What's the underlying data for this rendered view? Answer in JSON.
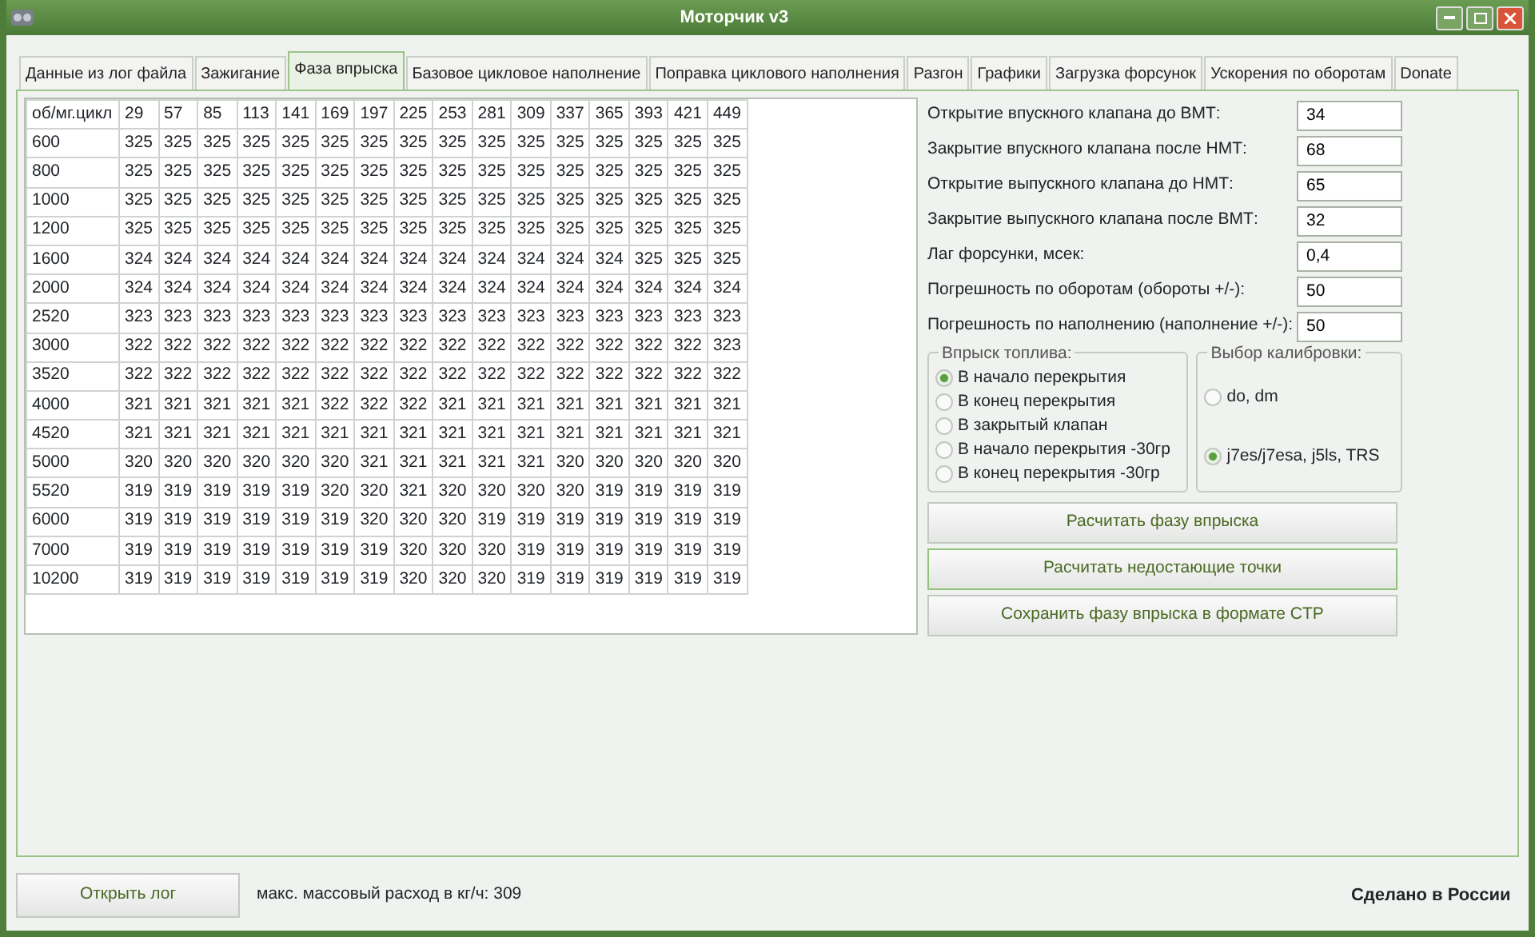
{
  "window": {
    "title": "Моторчик v3"
  },
  "tabs": [
    {
      "label": "Данные из лог файла",
      "selected": false
    },
    {
      "label": "Зажигание",
      "selected": false
    },
    {
      "label": "Фаза впрыска",
      "selected": true
    },
    {
      "label": "Базовое цикловое наполнение",
      "selected": false
    },
    {
      "label": "Поправка циклового наполнения",
      "selected": false
    },
    {
      "label": "Разгон",
      "selected": false
    },
    {
      "label": "Графики",
      "selected": false
    },
    {
      "label": "Загрузка форсунок",
      "selected": false
    },
    {
      "label": "Ускорения по оборотам",
      "selected": false
    },
    {
      "label": "Donate",
      "selected": false
    }
  ],
  "table": {
    "columns": [
      "об/мг.цикл",
      "29",
      "57",
      "85",
      "113",
      "141",
      "169",
      "197",
      "225",
      "253",
      "281",
      "309",
      "337",
      "365",
      "393",
      "421",
      "449"
    ],
    "rows": [
      [
        "600",
        "325",
        "325",
        "325",
        "325",
        "325",
        "325",
        "325",
        "325",
        "325",
        "325",
        "325",
        "325",
        "325",
        "325",
        "325",
        "325"
      ],
      [
        "800",
        "325",
        "325",
        "325",
        "325",
        "325",
        "325",
        "325",
        "325",
        "325",
        "325",
        "325",
        "325",
        "325",
        "325",
        "325",
        "325"
      ],
      [
        "1000",
        "325",
        "325",
        "325",
        "325",
        "325",
        "325",
        "325",
        "325",
        "325",
        "325",
        "325",
        "325",
        "325",
        "325",
        "325",
        "325"
      ],
      [
        "1200",
        "325",
        "325",
        "325",
        "325",
        "325",
        "325",
        "325",
        "325",
        "325",
        "325",
        "325",
        "325",
        "325",
        "325",
        "325",
        "325"
      ],
      [
        "1600",
        "324",
        "324",
        "324",
        "324",
        "324",
        "324",
        "324",
        "324",
        "324",
        "324",
        "324",
        "324",
        "324",
        "325",
        "325",
        "325"
      ],
      [
        "2000",
        "324",
        "324",
        "324",
        "324",
        "324",
        "324",
        "324",
        "324",
        "324",
        "324",
        "324",
        "324",
        "324",
        "324",
        "324",
        "324"
      ],
      [
        "2520",
        "323",
        "323",
        "323",
        "323",
        "323",
        "323",
        "323",
        "323",
        "323",
        "323",
        "323",
        "323",
        "323",
        "323",
        "323",
        "323"
      ],
      [
        "3000",
        "322",
        "322",
        "322",
        "322",
        "322",
        "322",
        "322",
        "322",
        "322",
        "322",
        "322",
        "322",
        "322",
        "322",
        "322",
        "323"
      ],
      [
        "3520",
        "322",
        "322",
        "322",
        "322",
        "322",
        "322",
        "322",
        "322",
        "322",
        "322",
        "322",
        "322",
        "322",
        "322",
        "322",
        "322"
      ],
      [
        "4000",
        "321",
        "321",
        "321",
        "321",
        "321",
        "322",
        "322",
        "322",
        "321",
        "321",
        "321",
        "321",
        "321",
        "321",
        "321",
        "321"
      ],
      [
        "4520",
        "321",
        "321",
        "321",
        "321",
        "321",
        "321",
        "321",
        "321",
        "321",
        "321",
        "321",
        "321",
        "321",
        "321",
        "321",
        "321"
      ],
      [
        "5000",
        "320",
        "320",
        "320",
        "320",
        "320",
        "320",
        "321",
        "321",
        "321",
        "321",
        "321",
        "320",
        "320",
        "320",
        "320",
        "320"
      ],
      [
        "5520",
        "319",
        "319",
        "319",
        "319",
        "319",
        "320",
        "320",
        "321",
        "320",
        "320",
        "320",
        "320",
        "319",
        "319",
        "319",
        "319"
      ],
      [
        "6000",
        "319",
        "319",
        "319",
        "319",
        "319",
        "319",
        "320",
        "320",
        "320",
        "319",
        "319",
        "319",
        "319",
        "319",
        "319",
        "319"
      ],
      [
        "7000",
        "319",
        "319",
        "319",
        "319",
        "319",
        "319",
        "319",
        "320",
        "320",
        "320",
        "319",
        "319",
        "319",
        "319",
        "319",
        "319"
      ],
      [
        "10200",
        "319",
        "319",
        "319",
        "319",
        "319",
        "319",
        "319",
        "320",
        "320",
        "320",
        "319",
        "319",
        "319",
        "319",
        "319",
        "319"
      ]
    ]
  },
  "fields": [
    {
      "label": "Открытие впускного клапана до ВМТ:",
      "value": "34"
    },
    {
      "label": "Закрытие впускного клапана после НМТ:",
      "value": "68"
    },
    {
      "label": "Открытие выпускного клапана до НМТ:",
      "value": "65"
    },
    {
      "label": "Закрытие выпускного клапана после ВМТ:",
      "value": "32"
    },
    {
      "label": "Лаг форсунки, мсек:",
      "value": "0,4"
    },
    {
      "label": "Погрешность по оборотам (обороты +/-):",
      "value": "50"
    },
    {
      "label": "Погрешность по наполнению (наполнение +/-):",
      "value": "50"
    }
  ],
  "injection_group": {
    "title": "Впрыск топлива:",
    "options": [
      {
        "label": "В начало перекрытия",
        "selected": true
      },
      {
        "label": "В конец перекрытия",
        "selected": false
      },
      {
        "label": "В закрытый клапан",
        "selected": false
      },
      {
        "label": "В начало перекрытия -30гр",
        "selected": false
      },
      {
        "label": "В конец перекрытия -30гр",
        "selected": false
      }
    ]
  },
  "calibration_group": {
    "title": "Выбор калибровки:",
    "options": [
      {
        "label": "do, dm",
        "selected": false
      },
      {
        "label": "j7es/j7esa, j5ls, TRS",
        "selected": true
      }
    ]
  },
  "buttons": [
    {
      "label": "Расчитать фазу впрыска",
      "focused": false
    },
    {
      "label": "Расчитать недостающие точки",
      "focused": true
    },
    {
      "label": "Сохранить фазу впрыска в формате CTP",
      "focused": false
    }
  ],
  "footer": {
    "open_button": "Открыть лог",
    "info": "макс. массовый расход в кг/ч: 309",
    "credit": "Сделано в России"
  }
}
